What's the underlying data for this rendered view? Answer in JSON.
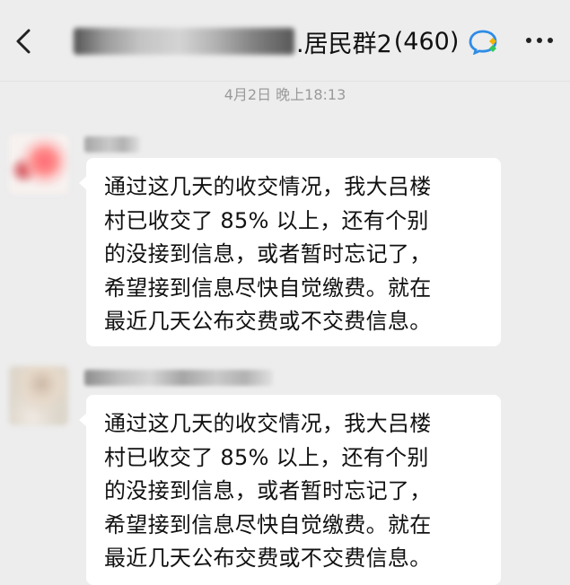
{
  "header": {
    "title_suffix": ".居民群2",
    "member_count": "(460)",
    "back_icon": "chevron-left-icon",
    "work_icon": "wechat-work-icon",
    "more_icon": "more-dots-icon"
  },
  "timestamp": "4月2日 晚上18:13",
  "messages": [
    {
      "text": "通过这几天的收交情况，我大吕楼\n村已收交了 85% 以上，还有个别\n的没接到信息，或者暂时忘记了，\n希望接到信息尽快自觉缴费。就在\n最近几天公布交费或不交费信息。"
    },
    {
      "text": "通过这几天的收交情况，我大吕楼\n村已收交了 85% 以上，还有个别\n的没接到信息，或者暂时忘记了，\n希望接到信息尽快自觉缴费。就在\n最近几天公布交费或不交费信息。"
    }
  ],
  "colors": {
    "background": "#ededed",
    "bubble": "#ffffff",
    "text": "#111111",
    "timestamp": "#9a9a9a",
    "work_icon_blue": "#2f8ce6",
    "work_icon_green": "#34c759"
  }
}
